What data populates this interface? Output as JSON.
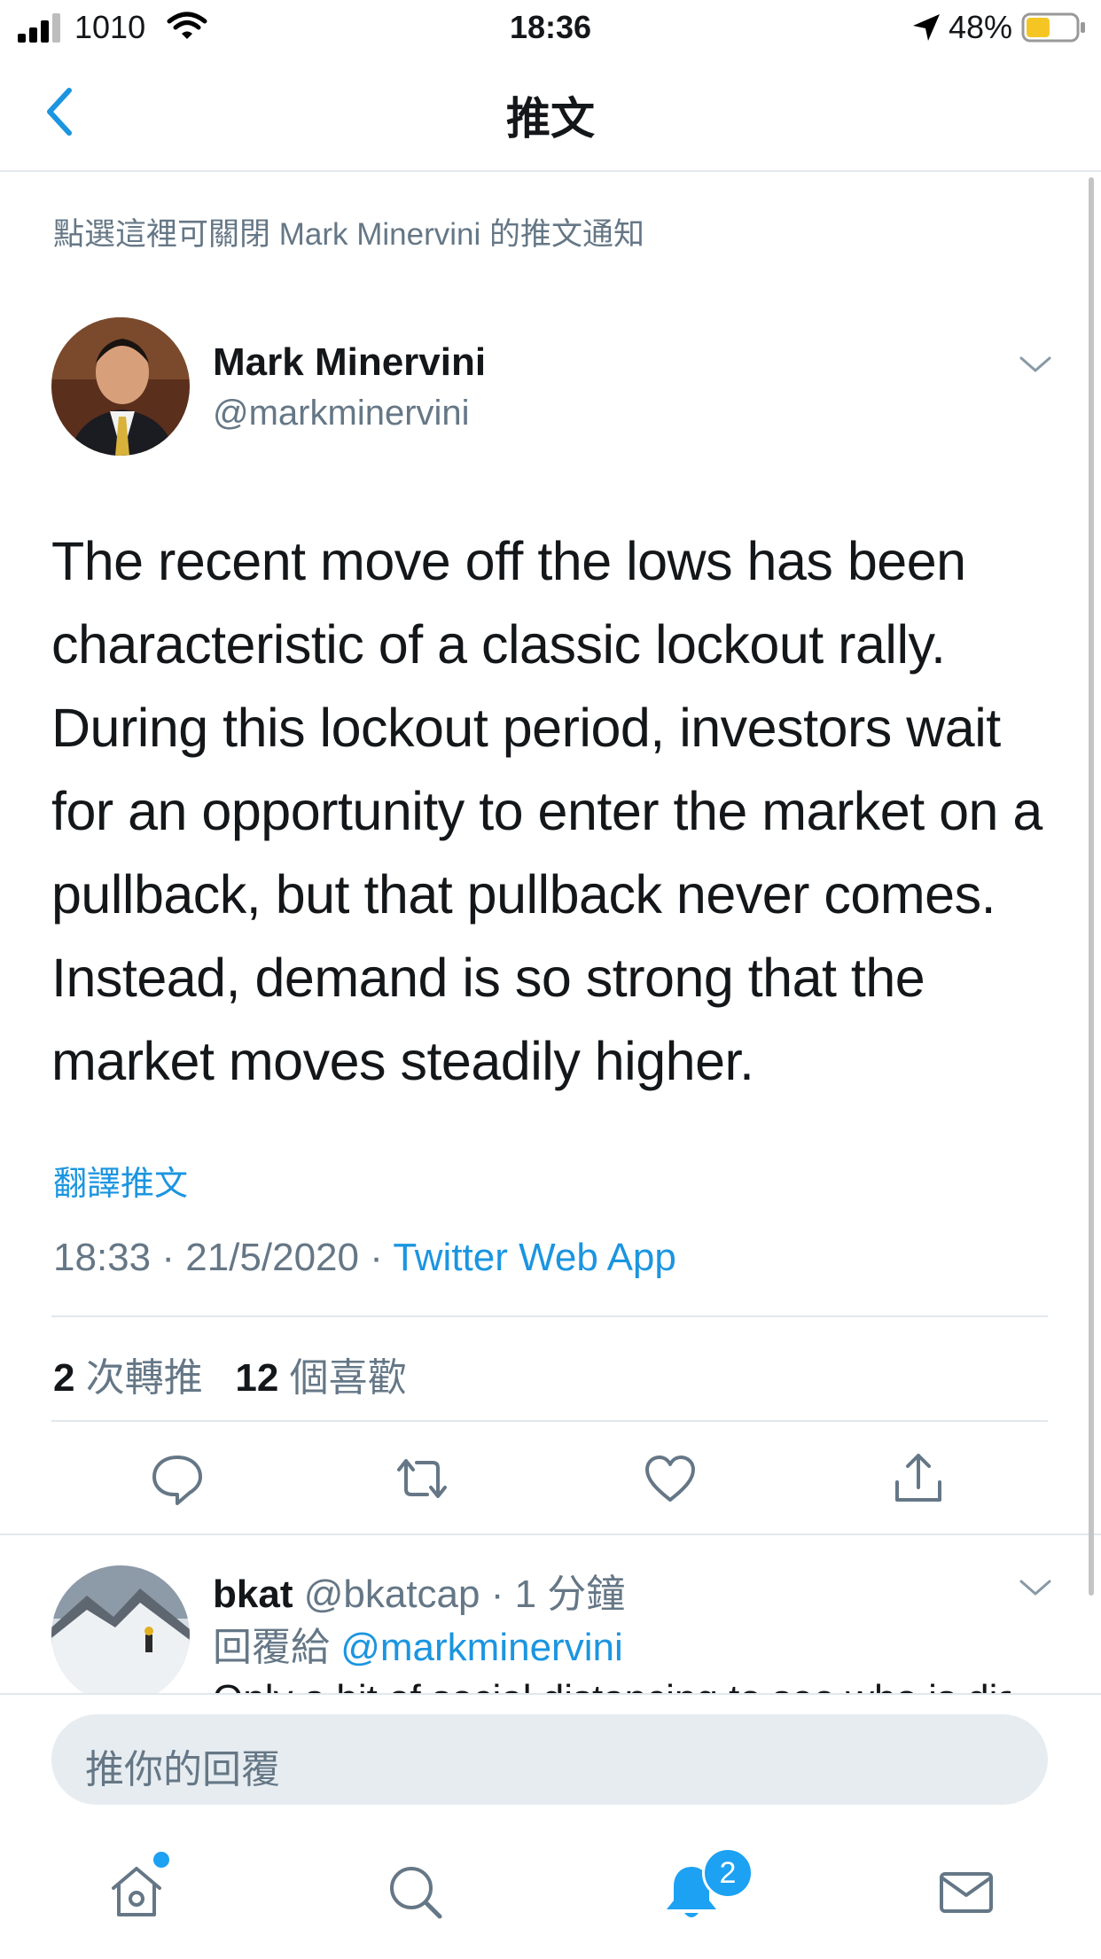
{
  "status_bar": {
    "carrier": "1010",
    "time": "18:36",
    "battery_pct": "48%",
    "battery_level": 0.48,
    "battery_color": "#f5c623"
  },
  "nav": {
    "title": "推文",
    "back_icon": "chevron-left-icon"
  },
  "notification": {
    "text": "點選這裡可關閉 Mark Minervini 的推文通知"
  },
  "tweet": {
    "author_name": "Mark Minervini",
    "author_handle": "@markminervini",
    "text": "The recent move off the lows has been characteristic of a classic lockout rally. During this lockout period, investors wait for an opportunity to enter the market on a pullback, but that pullback never comes. Instead, demand is so strong that the market moves steadily higher.",
    "translate_label": "翻譯推文",
    "time": "18:33",
    "date": "21/5/2020",
    "separator": "·",
    "source": "Twitter Web App",
    "retweets_count": "2",
    "retweets_label": "次轉推",
    "likes_count": "12",
    "likes_label": "個喜歡"
  },
  "actions": [
    "reply-icon",
    "retweet-icon",
    "like-icon",
    "share-icon"
  ],
  "reply": {
    "name": "bkat",
    "handle": "@bkatcap",
    "time": "· 1 分鐘",
    "reply_to_label": "回覆給",
    "reply_to_handle": "@markminervini",
    "text_partial": "Only a bit of social distancing to see who is dis"
  },
  "compose": {
    "placeholder": "推你的回覆"
  },
  "tab_bar": {
    "items": [
      "home-icon",
      "search-icon",
      "notifications-icon",
      "messages-icon"
    ],
    "notifications_badge": "2"
  },
  "colors": {
    "accent": "#1b95e0",
    "muted": "#657786",
    "text": "#14171a",
    "border": "#e1e8ed"
  }
}
